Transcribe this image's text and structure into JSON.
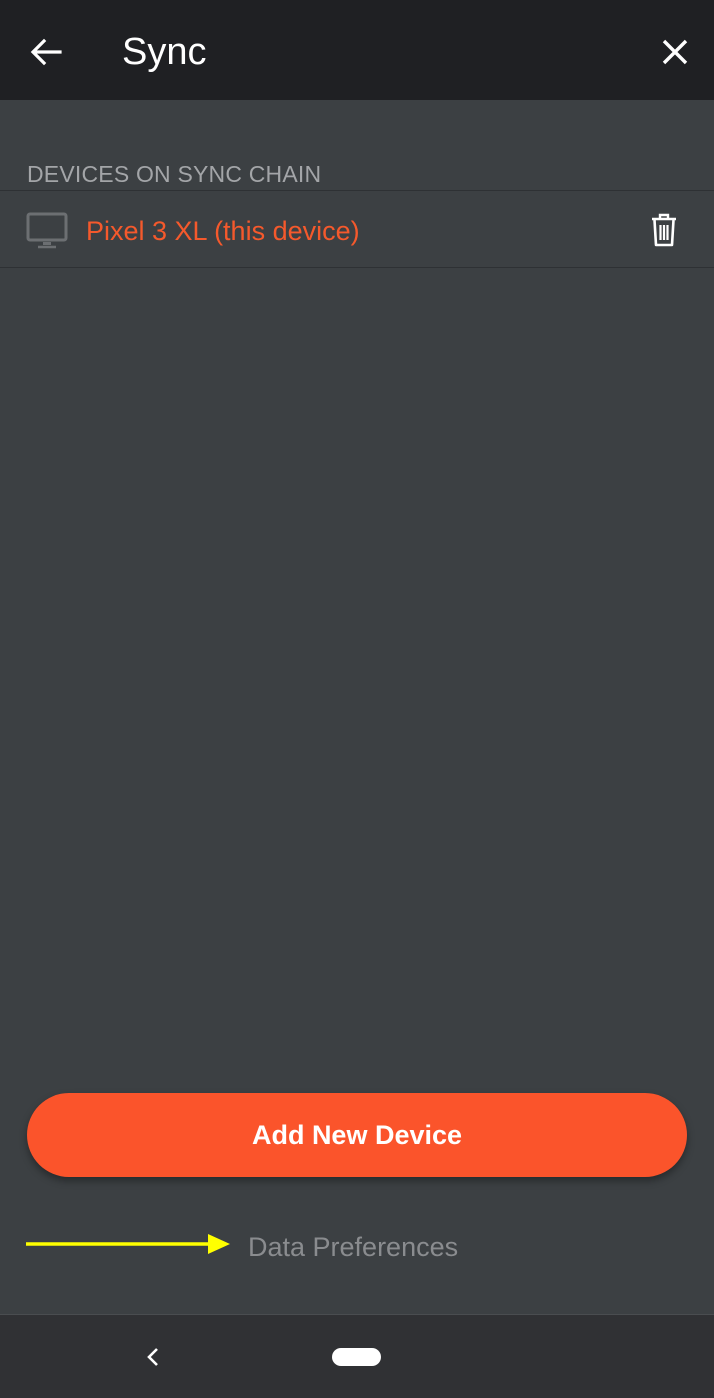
{
  "header": {
    "title": "Sync",
    "back_icon": "arrow-left-icon",
    "close_icon": "close-icon"
  },
  "section": {
    "label": "DEVICES ON SYNC CHAIN"
  },
  "devices": [
    {
      "name": "Pixel 3 XL (this device)",
      "icon": "monitor-icon",
      "action_icon": "trash-icon"
    }
  ],
  "actions": {
    "add_device_label": "Add New Device",
    "data_preferences_label": "Data Preferences"
  },
  "annotation": {
    "arrow_color": "#ffff00"
  },
  "colors": {
    "accent": "#fb542b",
    "device_name": "#f5592c",
    "background": "#3c4043",
    "topbar": "#1f2023"
  }
}
